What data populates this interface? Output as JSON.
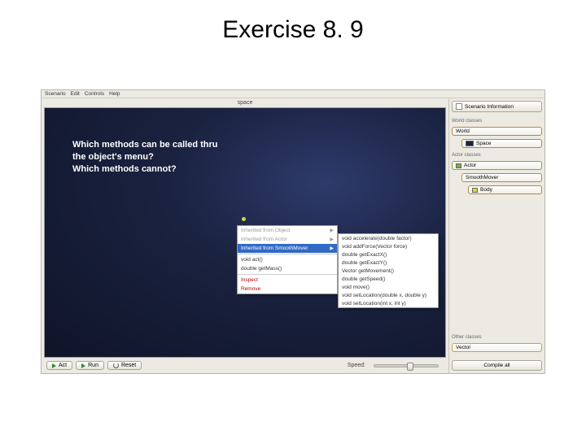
{
  "slide_title": "Exercise 8. 9",
  "menubar": {
    "items": [
      "Scenario",
      "Edit",
      "Controls",
      "Help"
    ]
  },
  "world_title": "space",
  "question": {
    "line1": "Which methods can be called thru",
    "line2": "the object's menu?",
    "line3": "Which methods cannot?"
  },
  "context_menu": {
    "items": [
      {
        "label": "Inherited from Object",
        "arrow": true,
        "disabled": true
      },
      {
        "label": "Inherited from Actor",
        "arrow": true,
        "disabled": true
      },
      {
        "label": "Inherited from SmoothMover",
        "arrow": true,
        "highlight": true
      },
      {
        "sep": true
      },
      {
        "label": "void act()"
      },
      {
        "label": "double getMass()"
      },
      {
        "sep": true
      },
      {
        "label": "Inspect",
        "red": true
      },
      {
        "label": "Remove",
        "red": true
      }
    ]
  },
  "submenu": {
    "items": [
      {
        "label": "void accelerate(double factor)"
      },
      {
        "label": "void addForce(Vector force)"
      },
      {
        "label": "double getExactX()"
      },
      {
        "label": "double getExactY()"
      },
      {
        "label": "Vector getMovement()"
      },
      {
        "label": "double getSpeed()"
      },
      {
        "label": "void move()"
      },
      {
        "label": "void setLocation(double x, double y)"
      },
      {
        "label": "void setLocation(int x, int y)"
      }
    ]
  },
  "controls": {
    "act": "Act",
    "run": "Run",
    "reset": "Reset",
    "speed": "Speed:"
  },
  "right_panel": {
    "scenario_info": "Scenario Information",
    "world_classes": "World classes",
    "world": "World",
    "space": "Space",
    "actor_classes": "Actor classes",
    "actor": "Actor",
    "smooth_mover": "SmoothMover",
    "body": "Body",
    "other_classes": "Other classes",
    "vector": "Vector",
    "compile": "Compile all"
  }
}
